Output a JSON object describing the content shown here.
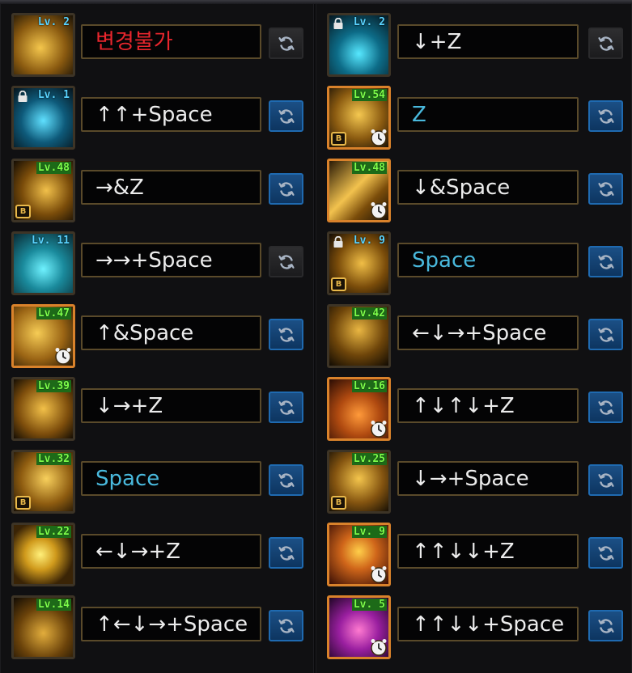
{
  "colors": {
    "accent_gold": "#d8a43a",
    "level_green": "#7dff4a",
    "level_blue": "#59d3ff",
    "text_red": "#e8262d",
    "text_cyan": "#49b9dd",
    "button_blue": "#1b4f85"
  },
  "columns": [
    {
      "skills": [
        {
          "level": "Lv. 2",
          "level_style": "blue",
          "locked": false,
          "b_badge": false,
          "timer": false,
          "art": "gold-beast",
          "command": "변경불가",
          "command_style": "red",
          "button": "disabled"
        },
        {
          "level": "Lv. 1",
          "level_style": "blue",
          "locked": true,
          "b_badge": false,
          "timer": false,
          "art": "blue-wings",
          "command": "↑↑+Space",
          "command_style": "white",
          "button": "active"
        },
        {
          "level": "Lv.48",
          "level_style": "green",
          "locked": false,
          "b_badge": true,
          "timer": false,
          "art": "gold-splash",
          "command": "→&Z",
          "command_style": "white",
          "button": "active"
        },
        {
          "level": "Lv. 11",
          "level_style": "blue",
          "locked": false,
          "b_badge": false,
          "timer": false,
          "art": "cyan-drop",
          "command": "→→+Space",
          "command_style": "white",
          "button": "disabled"
        },
        {
          "level": "Lv.47",
          "level_style": "green",
          "locked": false,
          "b_badge": false,
          "timer": true,
          "art": "gold-swirl",
          "command": "↑&Space",
          "command_style": "white",
          "button": "active"
        },
        {
          "level": "Lv.39",
          "level_style": "green",
          "locked": false,
          "b_badge": false,
          "timer": false,
          "art": "gold-fangs",
          "command": "↓→+Z",
          "command_style": "white",
          "button": "active"
        },
        {
          "level": "Lv.32",
          "level_style": "green",
          "locked": false,
          "b_badge": true,
          "timer": false,
          "art": "gold-strike",
          "command": "Space",
          "command_style": "cyan",
          "button": "active"
        },
        {
          "level": "Lv.22",
          "level_style": "green",
          "locked": false,
          "b_badge": false,
          "timer": false,
          "art": "gold-burst",
          "command": "←↓→+Z",
          "command_style": "white",
          "button": "active"
        },
        {
          "level": "Lv.14",
          "level_style": "green",
          "locked": false,
          "b_badge": false,
          "timer": false,
          "art": "gold-dash",
          "command": "↑←↓→+Space",
          "command_style": "white",
          "button": "active"
        }
      ]
    },
    {
      "skills": [
        {
          "level": "Lv. 2",
          "level_style": "blue",
          "locked": true,
          "b_badge": false,
          "timer": false,
          "art": "blue-flames",
          "command": "↓+Z",
          "command_style": "white",
          "button": "disabled"
        },
        {
          "level": "Lv.54",
          "level_style": "green",
          "locked": false,
          "b_badge": true,
          "timer": true,
          "art": "gold-dragon",
          "command": "Z",
          "command_style": "cyan",
          "button": "active"
        },
        {
          "level": "Lv.48",
          "level_style": "green",
          "locked": false,
          "b_badge": false,
          "timer": true,
          "art": "gold-slash",
          "command": "↓&Space",
          "command_style": "white",
          "button": "active"
        },
        {
          "level": "Lv. 9",
          "level_style": "blue",
          "locked": true,
          "b_badge": true,
          "timer": false,
          "art": "gold-roar",
          "command": "Space",
          "command_style": "cyan",
          "button": "active"
        },
        {
          "level": "Lv.42",
          "level_style": "green",
          "locked": false,
          "b_badge": false,
          "timer": false,
          "art": "gold-figure",
          "command": "←↓→+Space",
          "command_style": "white",
          "button": "active"
        },
        {
          "level": "Lv.16",
          "level_style": "green",
          "locked": false,
          "b_badge": false,
          "timer": true,
          "art": "orange-eye",
          "command": "↑↓↑↓+Z",
          "command_style": "white",
          "button": "active"
        },
        {
          "level": "Lv.25",
          "level_style": "green",
          "locked": false,
          "b_badge": true,
          "timer": false,
          "art": "gold-beast-head",
          "command": "↓→+Space",
          "command_style": "white",
          "button": "active"
        },
        {
          "level": "Lv. 9",
          "level_style": "green",
          "locked": false,
          "b_badge": false,
          "timer": true,
          "art": "fire-dragon",
          "command": "↑↑↓↓+Z",
          "command_style": "white",
          "button": "active"
        },
        {
          "level": "Lv. 5",
          "level_style": "green",
          "locked": false,
          "b_badge": false,
          "timer": true,
          "art": "purple-fire",
          "command": "↑↑↓↓+Space",
          "command_style": "white",
          "button": "active"
        }
      ]
    }
  ]
}
